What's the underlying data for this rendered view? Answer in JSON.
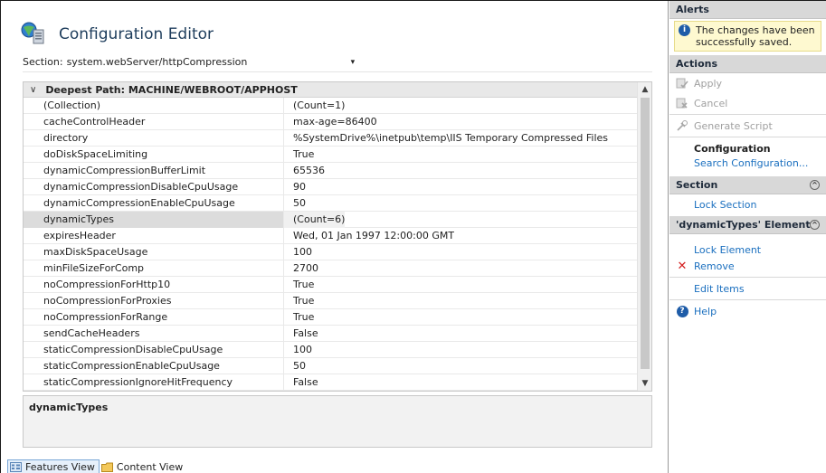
{
  "editor": {
    "title": "Configuration Editor",
    "section_label": "Section:",
    "section_value": "system.webServer/httpCompression",
    "dropdown_glyph": "▾"
  },
  "grid": {
    "header": "Deepest Path: MACHINE/WEBROOT/APPHOST",
    "collapse_glyph": "∨",
    "rows": [
      {
        "key": "(Collection)",
        "value": "(Count=1)"
      },
      {
        "key": "cacheControlHeader",
        "value": "max-age=86400"
      },
      {
        "key": "directory",
        "value": "%SystemDrive%\\inetpub\\temp\\IIS Temporary Compressed Files"
      },
      {
        "key": "doDiskSpaceLimiting",
        "value": "True"
      },
      {
        "key": "dynamicCompressionBufferLimit",
        "value": "65536"
      },
      {
        "key": "dynamicCompressionDisableCpuUsage",
        "value": "90"
      },
      {
        "key": "dynamicCompressionEnableCpuUsage",
        "value": "50"
      },
      {
        "key": "dynamicTypes",
        "value": "(Count=6)"
      },
      {
        "key": "expiresHeader",
        "value": "Wed, 01 Jan 1997 12:00:00 GMT"
      },
      {
        "key": "maxDiskSpaceUsage",
        "value": "100"
      },
      {
        "key": "minFileSizeForComp",
        "value": "2700"
      },
      {
        "key": "noCompressionForHttp10",
        "value": "True"
      },
      {
        "key": "noCompressionForProxies",
        "value": "True"
      },
      {
        "key": "noCompressionForRange",
        "value": "True"
      },
      {
        "key": "sendCacheHeaders",
        "value": "False"
      },
      {
        "key": "staticCompressionDisableCpuUsage",
        "value": "100"
      },
      {
        "key": "staticCompressionEnableCpuUsage",
        "value": "50"
      },
      {
        "key": "staticCompressionIgnoreHitFrequency",
        "value": "False"
      }
    ],
    "selected_row": "dynamicTypes",
    "scroll_up_glyph": "▲",
    "scroll_down_glyph": "▼"
  },
  "description": {
    "title": "dynamicTypes"
  },
  "bottom_tabs": {
    "features_view": "Features View",
    "content_view": "Content View"
  },
  "actions_pane": {
    "alerts_header": "Alerts",
    "alert_message": "The changes have been successfully saved.",
    "alert_icon": "i",
    "actions_header": "Actions",
    "apply": "Apply",
    "cancel": "Cancel",
    "generate_script": "Generate Script",
    "configuration": "Configuration",
    "search_configuration": "Search Configuration...",
    "section_header": "Section",
    "lock_section": "Lock Section",
    "element_header": "'dynamicTypes' Element",
    "lock_element": "Lock Element",
    "remove": "Remove",
    "edit_items": "Edit Items",
    "help": "Help",
    "collapse_glyph": "^",
    "remove_glyph": "✕",
    "help_glyph": "?"
  },
  "colors": {
    "link": "#1a6fbf",
    "disabled": "#a0a0a0",
    "alert_bg": "#fef9d0",
    "remove_red": "#d42020",
    "help_blue": "#1e5ca8"
  }
}
